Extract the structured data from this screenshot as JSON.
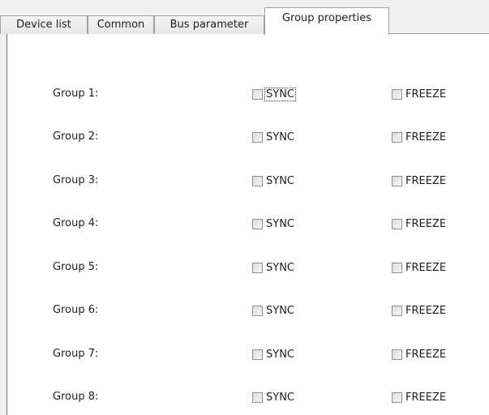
{
  "tabs": [
    {
      "label": "Device list"
    },
    {
      "label": "Common"
    },
    {
      "label": "Bus parameter"
    },
    {
      "label": "Group properties"
    }
  ],
  "groups": [
    {
      "label": "Group 1:",
      "sync_label": "SYNC",
      "freeze_label": "FREEZE",
      "sync_checked": false,
      "freeze_checked": false
    },
    {
      "label": "Group 2:",
      "sync_label": "SYNC",
      "freeze_label": "FREEZE",
      "sync_checked": false,
      "freeze_checked": false
    },
    {
      "label": "Group 3:",
      "sync_label": "SYNC",
      "freeze_label": "FREEZE",
      "sync_checked": false,
      "freeze_checked": false
    },
    {
      "label": "Group 4:",
      "sync_label": "SYNC",
      "freeze_label": "FREEZE",
      "sync_checked": false,
      "freeze_checked": false
    },
    {
      "label": "Group 5:",
      "sync_label": "SYNC",
      "freeze_label": "FREEZE",
      "sync_checked": false,
      "freeze_checked": false
    },
    {
      "label": "Group 6:",
      "sync_label": "SYNC",
      "freeze_label": "FREEZE",
      "sync_checked": false,
      "freeze_checked": false
    },
    {
      "label": "Group 7:",
      "sync_label": "SYNC",
      "freeze_label": "FREEZE",
      "sync_checked": false,
      "freeze_checked": false
    },
    {
      "label": "Group 8:",
      "sync_label": "SYNC",
      "freeze_label": "FREEZE",
      "sync_checked": false,
      "freeze_checked": false
    }
  ]
}
